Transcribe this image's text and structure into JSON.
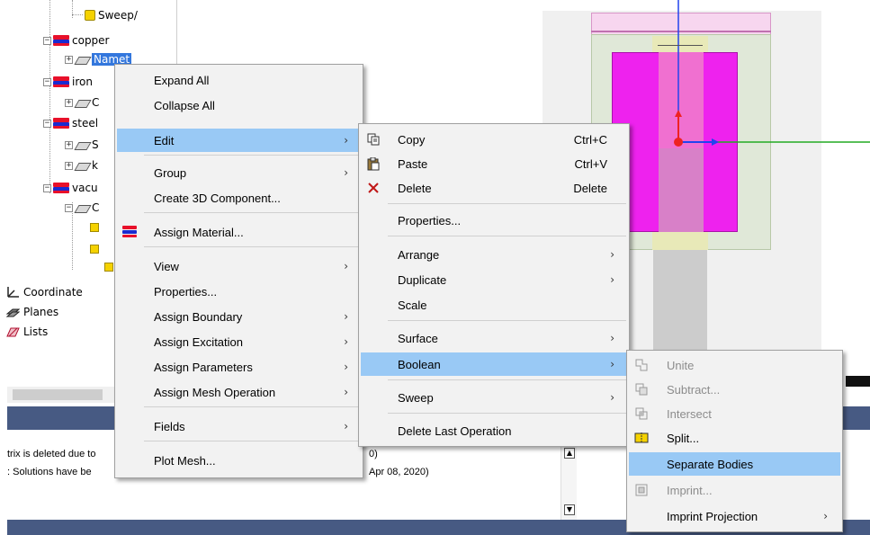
{
  "tree": {
    "items": [
      {
        "label": "Sweep/"
      },
      {
        "label": "copper"
      },
      {
        "label": "Namet"
      },
      {
        "label": "iron"
      },
      {
        "label": "C"
      },
      {
        "label": "steel"
      },
      {
        "label": "S"
      },
      {
        "label": "k"
      },
      {
        "label": "vacu"
      },
      {
        "label": "C"
      }
    ],
    "bottom_items": [
      {
        "label": "Coordinate"
      },
      {
        "label": "Planes"
      },
      {
        "label": "Lists"
      }
    ]
  },
  "messages": {
    "line1_left": "trix is deleted due to",
    "line1_right": "0)",
    "line2_left": ": Solutions have be",
    "line2_right": "Apr 08, 2020)"
  },
  "menu_main": {
    "items": [
      {
        "label": "Expand All"
      },
      {
        "label": "Collapse All"
      },
      {
        "label": "Edit"
      },
      {
        "label": "Group"
      },
      {
        "label": "Create 3D Component..."
      },
      {
        "label": "Assign Material..."
      },
      {
        "label": "View"
      },
      {
        "label": "Properties..."
      },
      {
        "label": "Assign Boundary"
      },
      {
        "label": "Assign Excitation"
      },
      {
        "label": "Assign Parameters"
      },
      {
        "label": "Assign Mesh Operation"
      },
      {
        "label": "Fields"
      },
      {
        "label": "Plot Mesh..."
      }
    ]
  },
  "menu_edit": {
    "items": [
      {
        "label": "Copy",
        "shortcut": "Ctrl+C"
      },
      {
        "label": "Paste",
        "shortcut": "Ctrl+V"
      },
      {
        "label": "Delete",
        "shortcut": "Delete"
      },
      {
        "label": "Properties..."
      },
      {
        "label": "Arrange"
      },
      {
        "label": "Duplicate"
      },
      {
        "label": "Scale"
      },
      {
        "label": "Surface"
      },
      {
        "label": "Boolean"
      },
      {
        "label": "Sweep"
      },
      {
        "label": "Delete Last Operation"
      }
    ]
  },
  "menu_boolean": {
    "items": [
      {
        "label": "Unite"
      },
      {
        "label": "Subtract..."
      },
      {
        "label": "Intersect"
      },
      {
        "label": "Split..."
      },
      {
        "label": "Separate Bodies"
      },
      {
        "label": "Imprint..."
      },
      {
        "label": "Imprint Projection"
      }
    ]
  },
  "submenu_arrow": "›",
  "colors": {
    "menu_bg": "#f2f2f2",
    "menu_highlight": "#99c9f5",
    "selection": "#3377dd",
    "status_band": "#475a83",
    "model_magenta": "#ee22ee"
  }
}
